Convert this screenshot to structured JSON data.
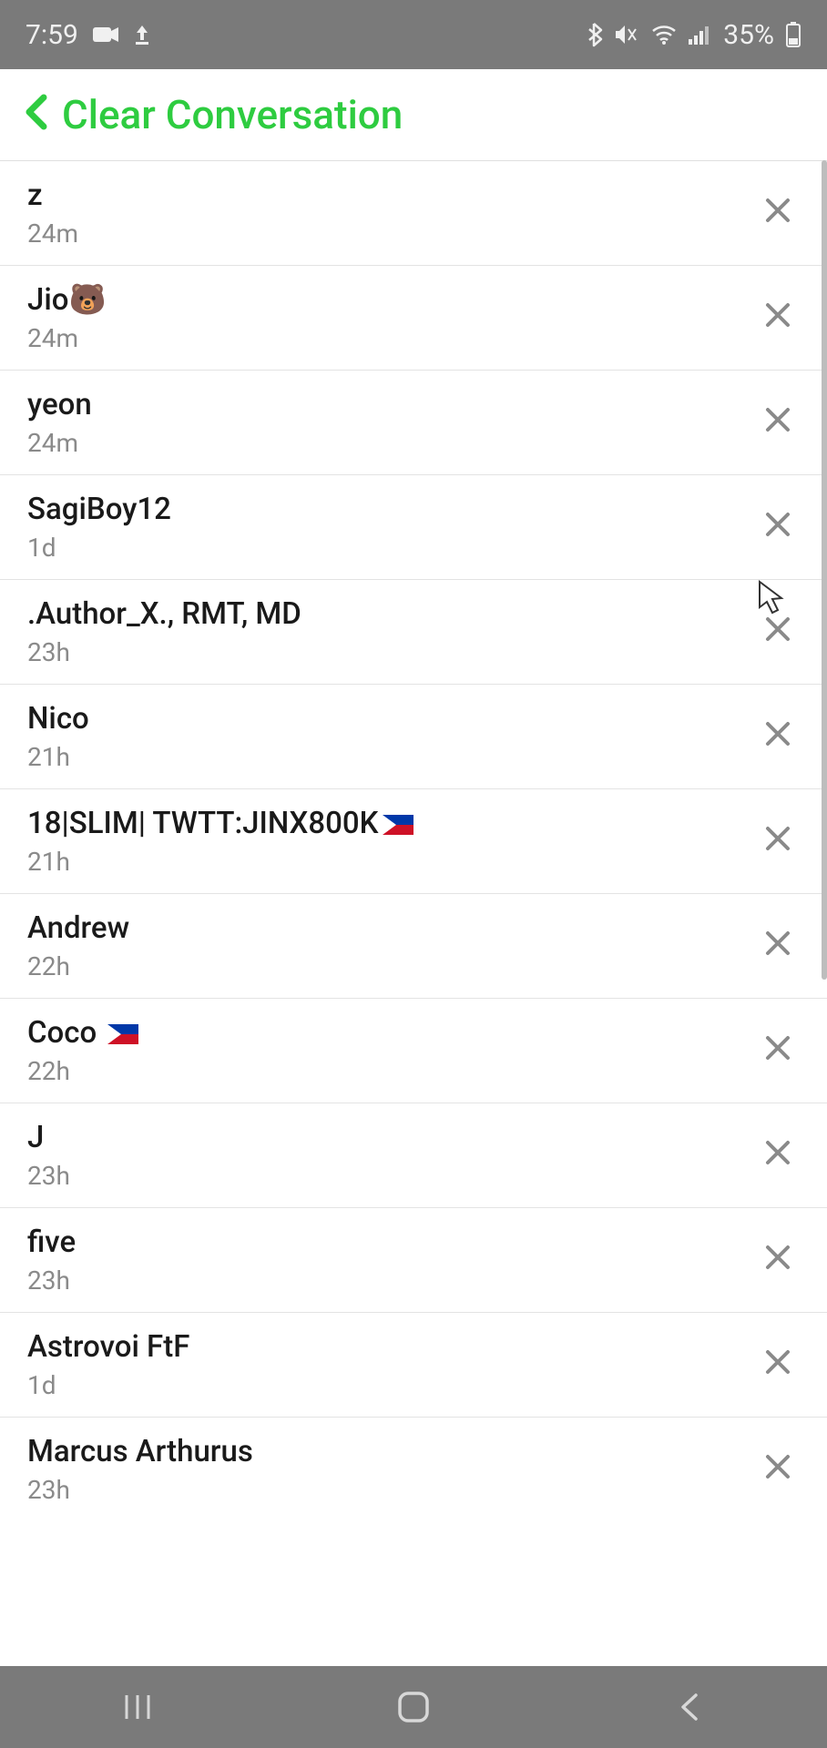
{
  "status_bar": {
    "time": "7:59",
    "battery_text": "35%"
  },
  "header": {
    "title": "Clear Conversation"
  },
  "conversations": [
    {
      "name": "z",
      "time": "24m"
    },
    {
      "name": "Jio🐻",
      "time": "24m"
    },
    {
      "name": "yeon",
      "time": "24m"
    },
    {
      "name": "SagiBoy12",
      "time": "1d"
    },
    {
      "name": ".Author_X., RMT, MD",
      "time": "23h"
    },
    {
      "name": "Nico",
      "time": "21h"
    },
    {
      "name": "18|SLIM| TWTT:JINX800K",
      "time": "21h",
      "flag": true
    },
    {
      "name": "Andrew",
      "time": "22h"
    },
    {
      "name": "Coco ",
      "time": "22h",
      "flag": true
    },
    {
      "name": "J",
      "time": "23h"
    },
    {
      "name": "five",
      "time": "23h"
    },
    {
      "name": "Astrovoi FtF",
      "time": "1d"
    },
    {
      "name": "Marcus Arthurus",
      "time": "23h"
    }
  ]
}
